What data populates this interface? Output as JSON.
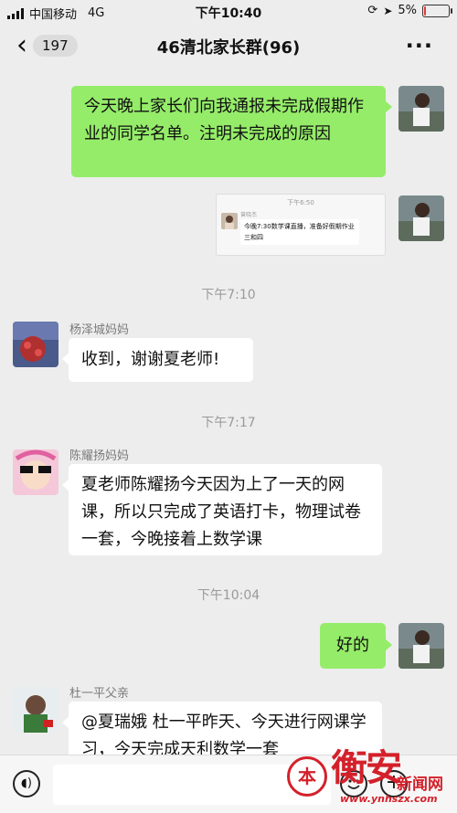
{
  "status_bar": {
    "carrier": "中国移动",
    "network": "4G",
    "time": "下午10:40",
    "battery": "5%",
    "battery_level": 0.05,
    "battery_color": "#e53935"
  },
  "nav": {
    "back_icon": "chevron-left-icon",
    "unread_count": "197",
    "title": "46清北家长群(96)",
    "more_icon": "more-dots-icon"
  },
  "colors": {
    "outgoing_bubble": "#95ec69",
    "incoming_bubble": "#ffffff",
    "background": "#ededed"
  },
  "messages": {
    "m1": {
      "text": "今天晚上家长们向我通报未完成假期作业的同学名单。注明未完成的原因"
    },
    "m2": {
      "time": "下午6:50",
      "name": "曾晓杰",
      "text": "今晚7:30数学课直播，准备好假期作业三和四"
    },
    "ts1": "下午7:10",
    "m3": {
      "sender": "杨泽城妈妈",
      "text": "收到，谢谢夏老师!"
    },
    "ts2": "下午7:17",
    "m4": {
      "sender": "陈耀扬妈妈",
      "text": "夏老师陈耀扬今天因为上了一天的网课，所以只完成了英语打卡，物理试卷一套，今晚接着上数学课"
    },
    "ts3": "下午10:04",
    "m5": {
      "text": "好的"
    },
    "m6": {
      "sender": "杜一平父亲",
      "text": "@夏瑞娥 杜一平昨天、今天进行网课学习，今天完成天利数学一套"
    }
  },
  "input_bar": {
    "voice_icon": "voice-icon",
    "emoji_icon": "emoji-icon",
    "plus_icon": "plus-icon",
    "placeholder": ""
  },
  "watermark": {
    "seal": "本",
    "name": "衡安",
    "sub": "新闻网",
    "url": "www.ynhszx.com"
  }
}
